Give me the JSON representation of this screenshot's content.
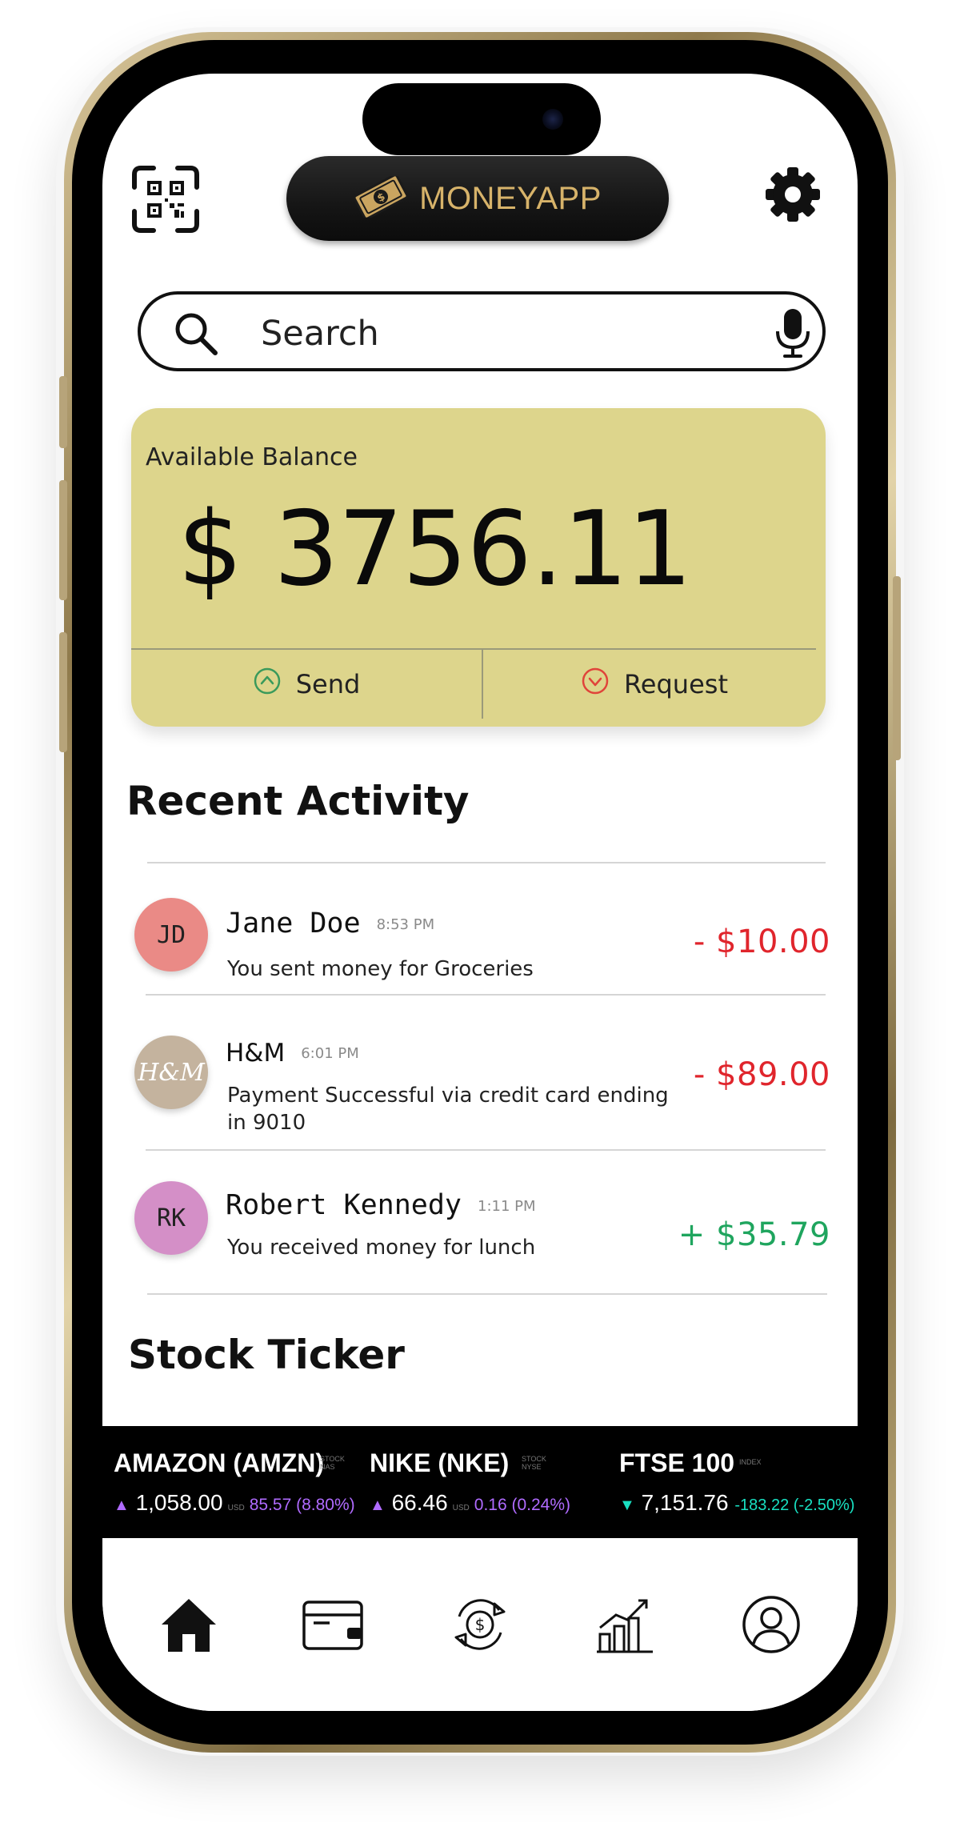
{
  "header": {
    "app_name": "MONEYAPP",
    "qr_icon": "qr-scan-icon",
    "logo_icon": "money-logo-icon",
    "settings_icon": "gear-icon"
  },
  "search": {
    "placeholder": "Search",
    "icon": "search-icon",
    "mic_icon": "mic-icon"
  },
  "balance": {
    "label": "Available Balance",
    "amount": "$ 3756.11",
    "send_label": "Send",
    "request_label": "Request",
    "colors": {
      "card": "#ddd58c",
      "send": "#3a9a5b",
      "request": "#e0443a"
    }
  },
  "recent": {
    "title": "Recent Activity",
    "items": [
      {
        "initials": "JD",
        "name": "Jane Doe",
        "time": "8:53 PM",
        "desc": "You sent money for Groceries",
        "amount": "- $10.00",
        "avatar_color": "#ea8a86"
      },
      {
        "initials": "H&M",
        "name": "H&M",
        "time": "6:01 PM",
        "desc": "Payment Successful via credit card ending in 9010",
        "amount": "- $89.00",
        "avatar_color": "#c4b39e"
      },
      {
        "initials": "RK",
        "name": "Robert Kennedy",
        "time": "1:11 PM",
        "desc": "You received money for lunch",
        "amount": "+ $35.79",
        "avatar_color": "#d48fc7"
      }
    ],
    "colors": {
      "negative": "#e0252c",
      "positive": "#1fa55e"
    }
  },
  "stocks": {
    "title": "Stock Ticker",
    "items": [
      {
        "name": "AMAZON (AMZN)",
        "tag_top": "STOCK",
        "tag_bottom": "NAS",
        "price": "1,058.00",
        "currency": "USD",
        "change": "85.57 (8.80%)",
        "direction": "up"
      },
      {
        "name": "NIKE (NKE)",
        "tag_top": "STOCK",
        "tag_bottom": "NYSE",
        "price": "66.46",
        "currency": "USD",
        "change": "0.16 (0.24%)",
        "direction": "up"
      },
      {
        "name": "FTSE 100",
        "tag_top": "INDEX",
        "tag_bottom": "",
        "price": "7,151.76",
        "currency": "",
        "change": "-183.22 (-2.50%)",
        "direction": "down"
      }
    ],
    "colors": {
      "up": "#b06bff",
      "down": "#19e0c2"
    }
  },
  "nav": {
    "items": [
      "home-icon",
      "wallet-icon",
      "exchange-icon",
      "chart-icon",
      "profile-icon"
    ],
    "active": "home-icon"
  }
}
